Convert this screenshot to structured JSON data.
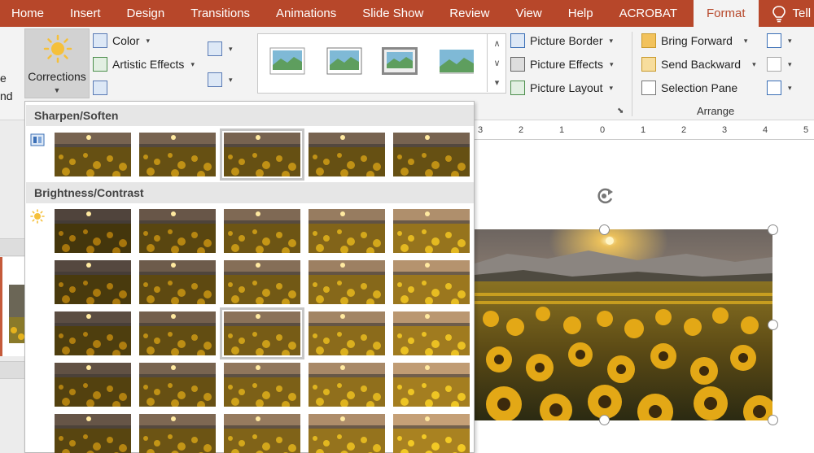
{
  "tabs": [
    {
      "label": "Home"
    },
    {
      "label": "Insert"
    },
    {
      "label": "Design"
    },
    {
      "label": "Transitions"
    },
    {
      "label": "Animations"
    },
    {
      "label": "Slide Show"
    },
    {
      "label": "Review"
    },
    {
      "label": "View"
    },
    {
      "label": "Help"
    },
    {
      "label": "ACROBAT"
    },
    {
      "label": "Format"
    }
  ],
  "tell_me": "Tell me wh",
  "ribbon": {
    "cut_text_1": "e",
    "cut_text_2": "nd",
    "corrections": "Corrections",
    "color": "Color",
    "artistic": "Artistic Effects",
    "picture_border": "Picture Border",
    "picture_effects": "Picture Effects",
    "picture_layout": "Picture Layout",
    "bring_forward": "Bring Forward",
    "send_backward": "Send Backward",
    "selection_pane": "Selection Pane",
    "arrange_label": "Arrange"
  },
  "ruler_ticks": [
    "3",
    "2",
    "1",
    "0",
    "1",
    "2",
    "3",
    "4",
    "5"
  ],
  "dropdown": {
    "sharpen_title": "Sharpen/Soften",
    "brightness_title": "Brightness/Contrast",
    "sharpen_selected_index": 2,
    "brightness_selected": [
      2,
      2
    ]
  },
  "colors": {
    "accent": "#b7472a",
    "ribbon_bg": "#f3f3f3",
    "header_bg": "#e6e6e6"
  },
  "icons": [
    "sun-icon",
    "color-icon",
    "artistic-effects-icon",
    "picture-border-icon",
    "picture-effects-icon",
    "picture-layout-icon",
    "bring-forward-icon",
    "send-backward-icon",
    "selection-pane-icon",
    "lightbulb-icon",
    "rotate-icon"
  ]
}
